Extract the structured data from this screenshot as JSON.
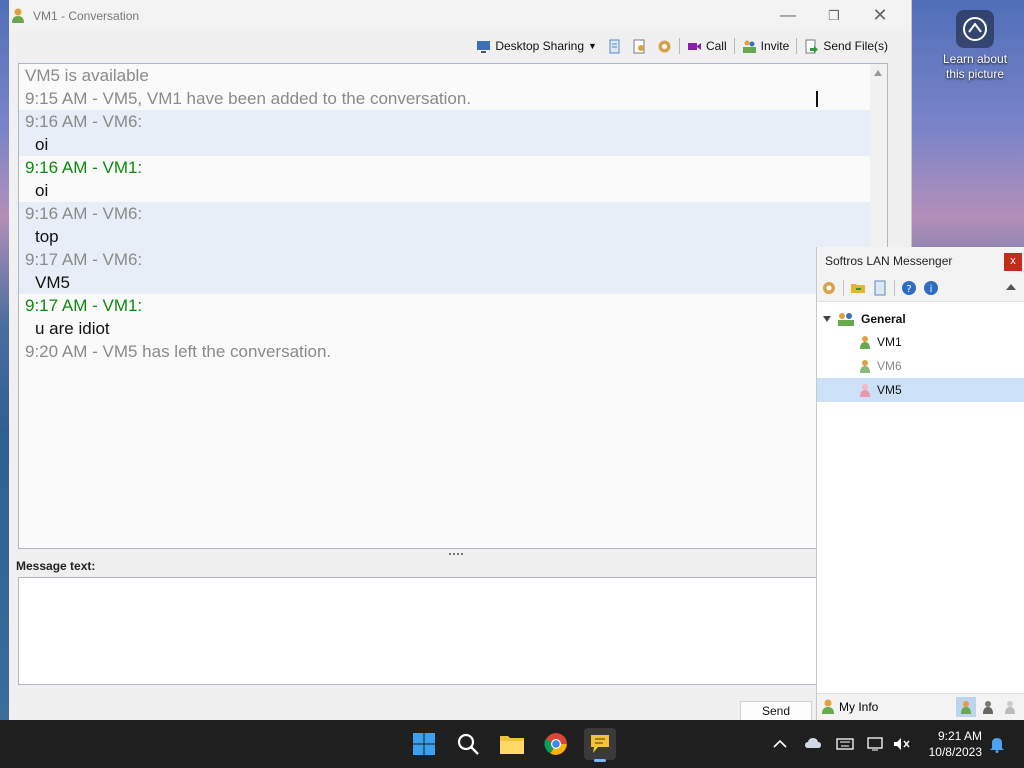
{
  "desktop": {
    "learn_label": "Learn about this picture"
  },
  "conversation": {
    "window_title": "VM1 - Conversation",
    "toolbar": {
      "desktop_sharing": "Desktop Sharing",
      "call": "Call",
      "invite": "Invite",
      "send_files": "Send File(s)"
    },
    "lines": [
      {
        "text": "VM5 is available",
        "kind": "system",
        "hl": false
      },
      {
        "text": "9:15 AM - VM5, VM1 have been added to the conversation.",
        "kind": "system",
        "hl": false
      },
      {
        "text": "9:16 AM - VM6:",
        "kind": "header-other",
        "hl": true
      },
      {
        "text": "oi",
        "kind": "msg",
        "hl": true
      },
      {
        "text": "9:16 AM - VM1:",
        "kind": "header-self",
        "hl": false
      },
      {
        "text": "oi",
        "kind": "msg",
        "hl": false
      },
      {
        "text": "9:16 AM - VM6:",
        "kind": "header-other",
        "hl": true
      },
      {
        "text": "top",
        "kind": "msg",
        "hl": true
      },
      {
        "text": "9:17 AM - VM6:",
        "kind": "header-other",
        "hl": true
      },
      {
        "text": "VM5",
        "kind": "msg",
        "hl": true
      },
      {
        "text": "9:17 AM - VM1:",
        "kind": "header-self",
        "hl": false
      },
      {
        "text": "u are idiot",
        "kind": "msg",
        "hl": false
      },
      {
        "text": "9:20 AM - VM5 has left the conversation.",
        "kind": "system",
        "hl": false
      }
    ],
    "message_label": "Message text:",
    "message_value": "",
    "send_label": "Send"
  },
  "messenger": {
    "title": "Softros LAN Messenger",
    "close_label": "x",
    "group": "General",
    "users": [
      {
        "name": "VM1",
        "status": "online"
      },
      {
        "name": "VM6",
        "status": "away"
      },
      {
        "name": "VM5",
        "status": "offline"
      }
    ],
    "my_info_label": "My Info"
  },
  "taskbar": {
    "time": "9:21 AM",
    "date": "10/8/2023"
  },
  "colors": {
    "self_header": "#0c8a0c",
    "system_text": "#8a8a8a",
    "highlight_row": "#e8eef7",
    "selected_user": "#cce0f7"
  }
}
